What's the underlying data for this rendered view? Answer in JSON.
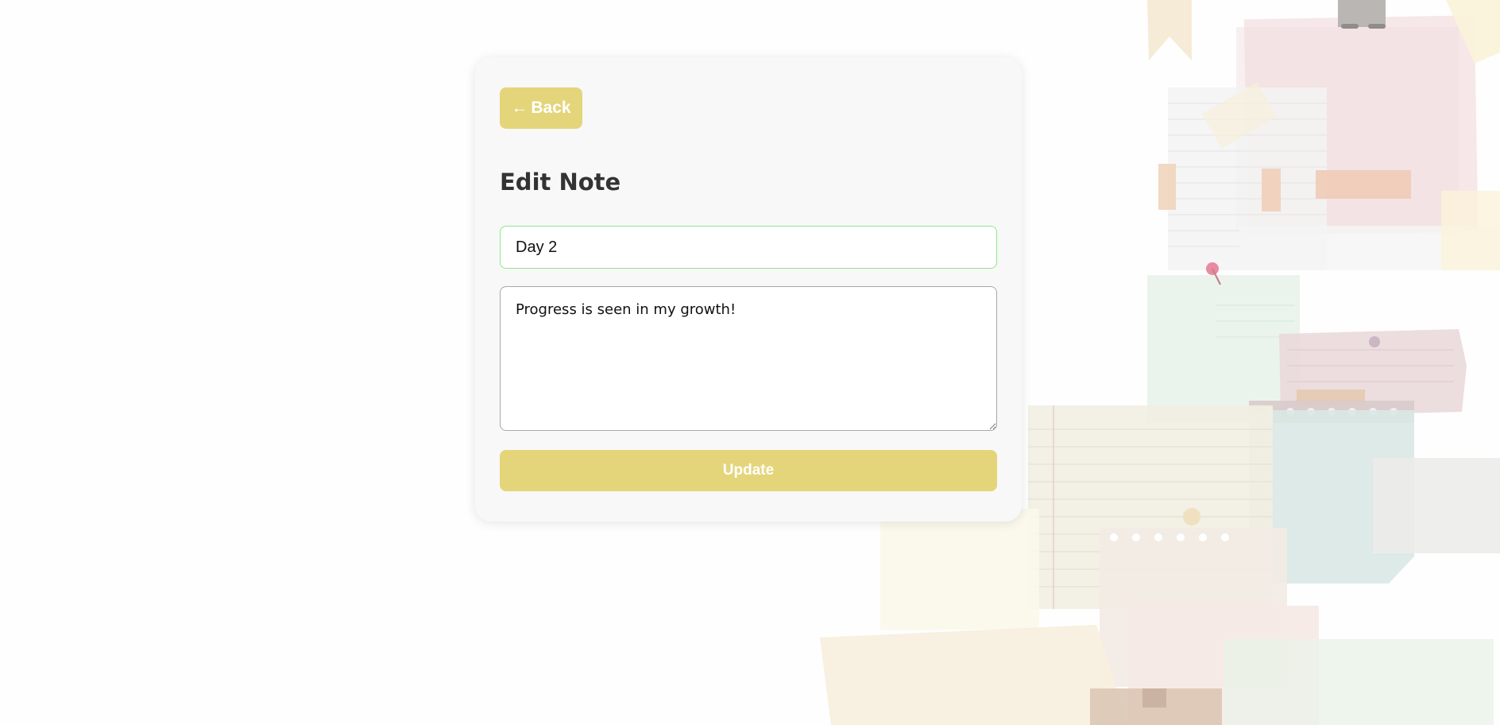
{
  "back_button": {
    "arrow_icon": "arrow-left-icon",
    "arrow_glyph": "←",
    "label": "Back"
  },
  "page_title": "Edit Note",
  "form": {
    "title_value": "Day 2",
    "body_value": "Progress is seen in my growth!",
    "submit_label": "Update"
  },
  "colors": {
    "accent": "#e4d57a",
    "card_background": "#f8f8f8",
    "focus_border": "#8fe88a"
  }
}
